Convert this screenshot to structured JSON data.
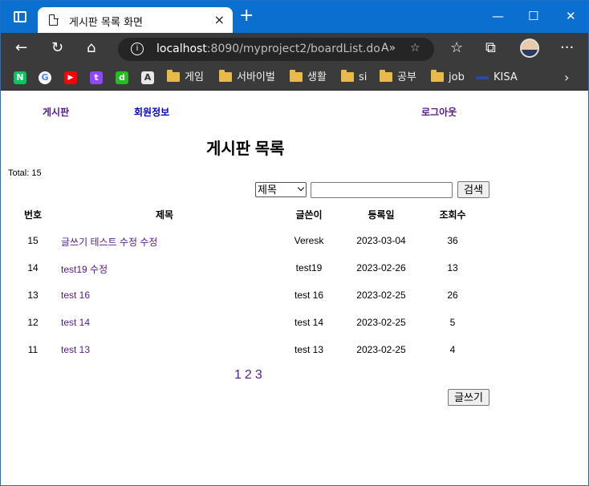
{
  "browser": {
    "tab_title": "게시판 목록 화면",
    "tab_close": "×",
    "new_tab": "+",
    "url_host": "localhost",
    "url_rest": ":8090/myproject2/boardList.do",
    "bookmarks": [
      {
        "label": "",
        "icon": "naver-icon",
        "badge": "N",
        "color": "#03c75a"
      },
      {
        "label": "",
        "icon": "google-icon",
        "badge": "G",
        "color": "#4285f4"
      },
      {
        "label": "",
        "icon": "youtube-icon",
        "badge": "▶",
        "color": "#ff0000"
      },
      {
        "label": "",
        "icon": "twitch-icon",
        "badge": "t",
        "color": "#9146ff"
      },
      {
        "label": "",
        "icon": "d-icon",
        "badge": "d",
        "color": "#20c020"
      },
      {
        "label": "",
        "icon": "a-icon",
        "badge": "A",
        "color": "#e8e8e8"
      },
      {
        "label": "게임",
        "icon": "folder-icon"
      },
      {
        "label": "서바이벌",
        "icon": "folder-icon"
      },
      {
        "label": "생활",
        "icon": "folder-icon"
      },
      {
        "label": "si",
        "icon": "folder-icon"
      },
      {
        "label": "공부",
        "icon": "folder-icon"
      },
      {
        "label": "job",
        "icon": "folder-icon"
      },
      {
        "label": "KISA",
        "icon": "kisa-icon"
      }
    ]
  },
  "menu": {
    "board": "게시판",
    "member_info": "회원정보",
    "logout": "로그아웃"
  },
  "heading": "게시판 목록",
  "total_text": "Total: 15",
  "search": {
    "select_value": "제목",
    "input_value": "",
    "button": "검색"
  },
  "table": {
    "headers": [
      "번호",
      "제목",
      "글쓴이",
      "등록일",
      "조회수"
    ],
    "rows": [
      {
        "no": "15",
        "title": "글쓰기 테스트 수정 수정",
        "writer": "Veresk",
        "date": "2023-03-04",
        "views": "36"
      },
      {
        "no": "14",
        "title": "test19 수정",
        "writer": "test19",
        "date": "2023-02-26",
        "views": "13"
      },
      {
        "no": "13",
        "title": "test 16",
        "writer": "test 16",
        "date": "2023-02-25",
        "views": "26"
      },
      {
        "no": "12",
        "title": "test 14",
        "writer": "test 14",
        "date": "2023-02-25",
        "views": "5"
      },
      {
        "no": "11",
        "title": "test 13",
        "writer": "test 13",
        "date": "2023-02-25",
        "views": "4"
      }
    ]
  },
  "pagination": [
    "1",
    "2",
    "3"
  ],
  "write_button": "글쓰기"
}
